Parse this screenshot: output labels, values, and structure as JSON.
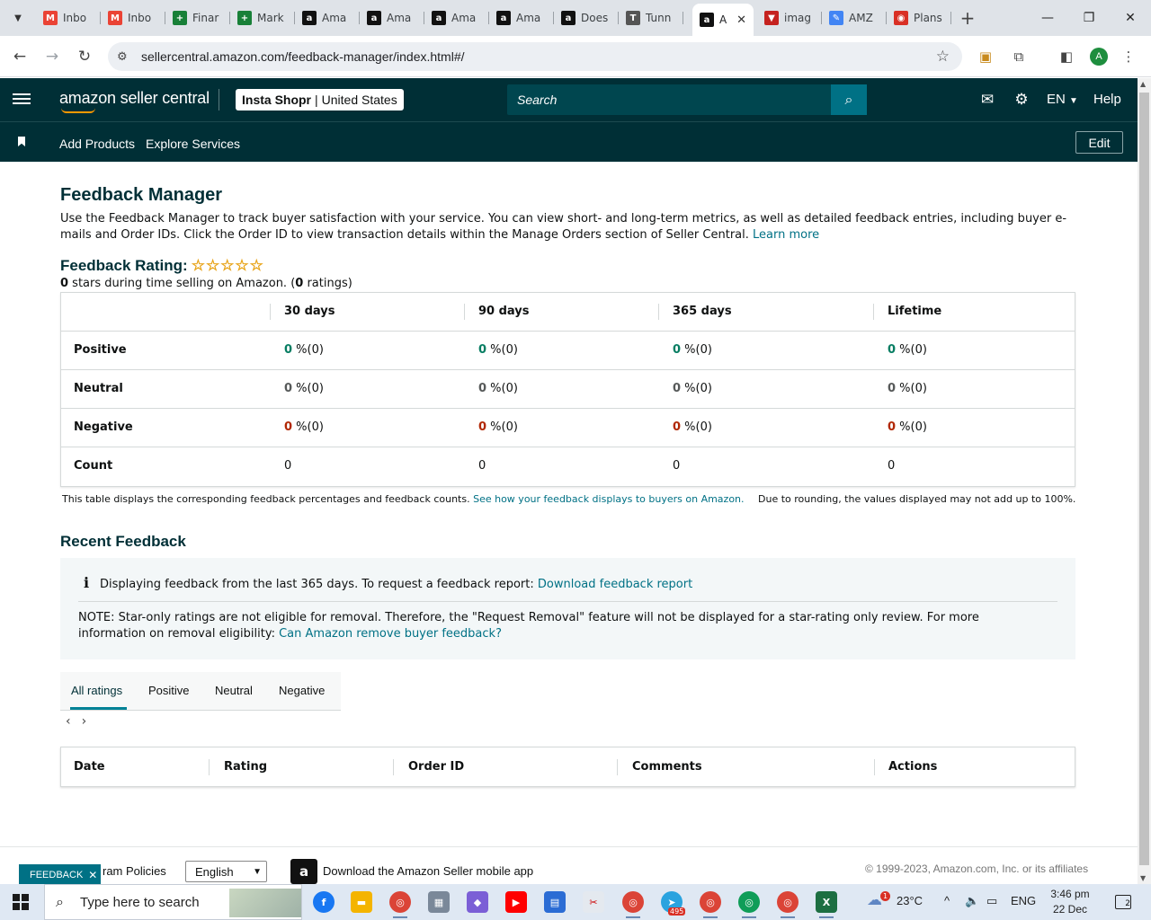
{
  "browser": {
    "tabs": [
      {
        "label": "Inbo",
        "icon": "gmail-icon",
        "color": "#ea4335",
        "glyph": "M"
      },
      {
        "label": "Inbo",
        "icon": "gmail-icon",
        "color": "#ea4335",
        "glyph": "M"
      },
      {
        "label": "Finar",
        "icon": "sheets-icon",
        "color": "#188038",
        "glyph": "+"
      },
      {
        "label": "Mark",
        "icon": "sheets-icon",
        "color": "#188038",
        "glyph": "+"
      },
      {
        "label": "Ama",
        "icon": "amazon-icon",
        "color": "#111111",
        "glyph": "a"
      },
      {
        "label": "Ama",
        "icon": "amazon-icon",
        "color": "#111111",
        "glyph": "a"
      },
      {
        "label": "Ama",
        "icon": "amazon-icon",
        "color": "#111111",
        "glyph": "a"
      },
      {
        "label": "Ama",
        "icon": "amazon-icon",
        "color": "#111111",
        "glyph": "a"
      },
      {
        "label": "Does",
        "icon": "amazon-icon",
        "color": "#111111",
        "glyph": "a"
      },
      {
        "label": "Tunn",
        "icon": "tunnel-icon",
        "color": "#555555",
        "glyph": "T"
      },
      {
        "label": "A",
        "icon": "amazon-icon",
        "color": "#111111",
        "glyph": "a",
        "active": true
      },
      {
        "label": "imag",
        "icon": "image-icon",
        "color": "#c5221f",
        "glyph": "▼"
      },
      {
        "label": "AMZ",
        "icon": "amz-icon",
        "color": "#4285f4",
        "glyph": "✎"
      },
      {
        "label": "Plans",
        "icon": "plans-icon",
        "color": "#d93025",
        "glyph": "◉"
      }
    ],
    "url": "sellercentral.amazon.com/feedback-manager/index.html#/",
    "profile_initial": "A"
  },
  "header": {
    "logo": "amazon seller central",
    "store": "Insta Shopr",
    "marketplace": "United States",
    "search_placeholder": "Search",
    "language": "EN",
    "help": "Help"
  },
  "subnav": {
    "items": [
      "Add Products",
      "Explore Services"
    ],
    "edit": "Edit"
  },
  "page": {
    "title": "Feedback Manager",
    "description": "Use the Feedback Manager to track buyer satisfaction with your service. You can view short- and long-term metrics, as well as detailed feedback entries, including buyer e-mails and Order IDs. Click the Order ID to view transaction details within the Manage Orders section of Seller Central.",
    "learn_more": "Learn more",
    "rating_title": "Feedback Rating:",
    "stars": "☆☆☆☆☆",
    "rating_count_stars": "0",
    "rating_text_mid": " stars during time selling on Amazon. (",
    "rating_count_ratings": "0",
    "rating_text_end": " ratings)"
  },
  "feedback_table": {
    "columns": [
      "30 days",
      "90 days",
      "365 days",
      "Lifetime"
    ],
    "rows": [
      {
        "label": "Positive",
        "values": [
          "0",
          "0",
          "0",
          "0"
        ],
        "suffix": " %(0)"
      },
      {
        "label": "Neutral",
        "values": [
          "0",
          "0",
          "0",
          "0"
        ],
        "suffix": " %(0)"
      },
      {
        "label": "Negative",
        "values": [
          "0",
          "0",
          "0",
          "0"
        ],
        "suffix": " %(0)"
      },
      {
        "label": "Count",
        "values": [
          "0",
          "0",
          "0",
          "0"
        ],
        "suffix": ""
      }
    ],
    "note": "This table displays the corresponding feedback percentages and feedback counts.",
    "note_link": "See how your feedback displays to buyers on Amazon.",
    "rounding_note": "Due to rounding, the values displayed may not add up to 100%."
  },
  "recent": {
    "title": "Recent Feedback",
    "info_text": "Displaying feedback from the last 365 days. To request a feedback report:",
    "info_link": "Download feedback report",
    "note_text": "NOTE: Star-only ratings are not eligible for removal. Therefore, the \"Request Removal\" feature will not be displayed for a star-rating only review. For more information on removal eligibility:",
    "note_link": "Can Amazon remove buyer feedback?",
    "tabs": [
      "All ratings",
      "Positive",
      "Neutral",
      "Negative"
    ],
    "selected_tab": "All ratings",
    "columns": [
      "Date",
      "Rating",
      "Order ID",
      "Comments",
      "Actions"
    ]
  },
  "footer": {
    "feedback_btn": "FEEDBACK",
    "program_policies": "ram Policies",
    "language": "English",
    "app_text": "Download the Amazon Seller mobile app",
    "copyright": "© 1999-2023, Amazon.com, Inc. or its affiliates"
  },
  "taskbar": {
    "search_placeholder": "Type here to search",
    "weather": "23°C",
    "weather_badge": "1",
    "lang": "ENG",
    "time": "3:46 pm",
    "date": "22 Dec 2023",
    "telegram_badge": "495",
    "notifications": "2"
  }
}
